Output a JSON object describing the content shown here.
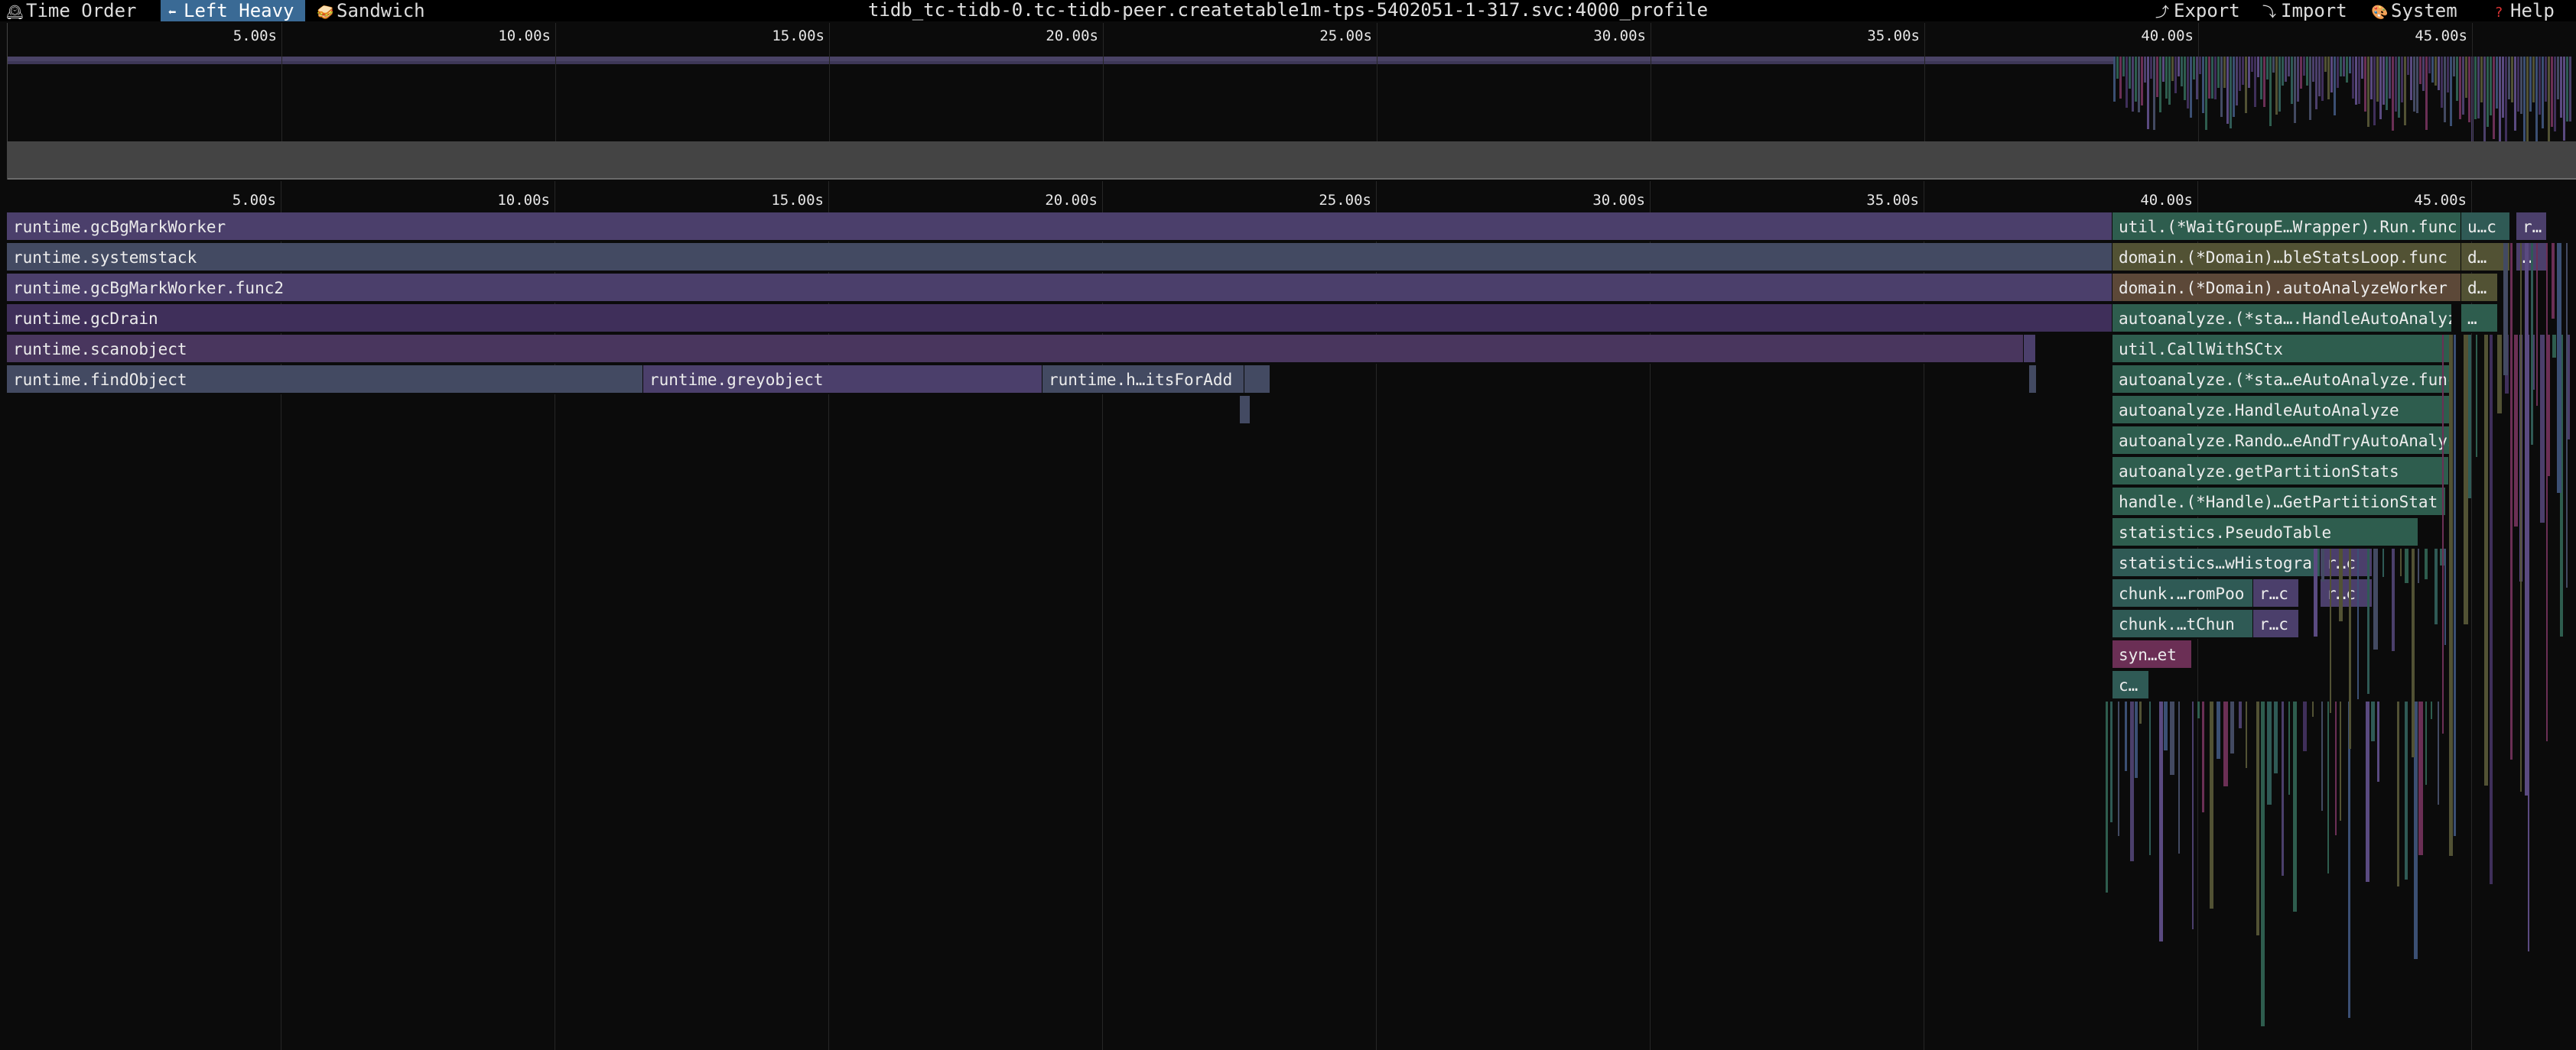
{
  "toolbar": {
    "time_order": "Time Order",
    "left_heavy": "Left Heavy",
    "sandwich": "Sandwich",
    "export": "Export",
    "import": "Import",
    "system": "System",
    "help": "Help",
    "icons": {
      "time_order": "clock-icon",
      "left_heavy": "left-arrow-icon",
      "sandwich": "sandwich-icon",
      "export": "export-icon",
      "import": "import-icon",
      "system": "palette-icon",
      "help": "question-icon"
    }
  },
  "title": "tidb_tc-tidb-0.tc-tidb-peer.createtable1m-tps-5402051-1-317.svc:4000_profile",
  "axis": {
    "ticks": [
      "5.00s",
      "10.00s",
      "15.00s",
      "20.00s",
      "25.00s",
      "30.00s",
      "35.00s",
      "40.00s",
      "45.00s"
    ]
  },
  "colors": {
    "toolbar_bg": "#000000",
    "active_tab": "#3a6a95",
    "background": "#0b0b0b",
    "purple": "#4b3f6b",
    "green": "#2e5d4e"
  },
  "flame": {
    "left_stack": [
      {
        "label": "runtime.gcBgMarkWorker"
      },
      {
        "label": "runtime.systemstack"
      },
      {
        "label": "runtime.gcBgMarkWorker.func2"
      },
      {
        "label": "runtime.gcDrain"
      },
      {
        "label": "runtime.scanobject"
      }
    ],
    "find_row": [
      {
        "label": "runtime.findObject"
      },
      {
        "label": "runtime.greyobject"
      },
      {
        "label": "runtime.h…itsForAdd"
      }
    ],
    "right_stack": [
      {
        "label": "util.(*WaitGroupE…Wrapper).Run.func"
      },
      {
        "label": "domain.(*Domain)…bleStatsLoop.func"
      },
      {
        "label": "domain.(*Domain).autoAnalyzeWorker"
      },
      {
        "label": "autoanalyze.(*sta….HandleAutoAnalyz"
      },
      {
        "label": "util.CallWithSCtx"
      },
      {
        "label": "autoanalyze.(*sta…eAutoAnalyze.func"
      },
      {
        "label": "autoanalyze.HandleAutoAnalyze"
      },
      {
        "label": "autoanalyze.Rando…eAndTryAutoAnalyz"
      },
      {
        "label": "autoanalyze.getPartitionStats"
      },
      {
        "label": "handle.(*Handle)…GetPartitionStat"
      },
      {
        "label": "statistics.PseudoTable"
      },
      {
        "label": "statistics…wHistogra"
      },
      {
        "label": "chunk.…romPoo"
      },
      {
        "label": "chunk.…tChun"
      },
      {
        "label": "syn…et"
      },
      {
        "label": "c…"
      }
    ],
    "side_labels": {
      "u_c": "u…c",
      "r1": "r…",
      "d1": "d…",
      "dots1": "…",
      "d2": "d…",
      "dots2": "…",
      "rc1": "r…c",
      "rc2": "r…c",
      "rc3": "r…c",
      "rc4": "r…c"
    }
  }
}
